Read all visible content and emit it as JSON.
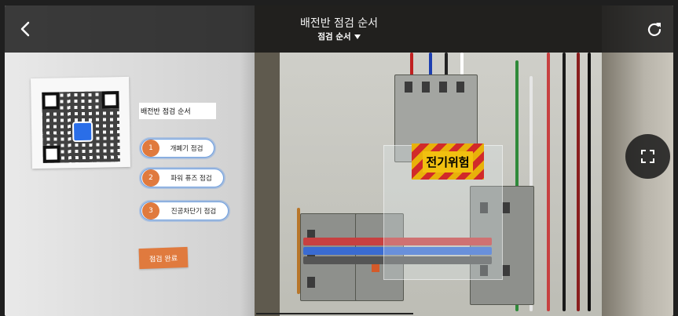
{
  "header": {
    "title": "배전반 점검 순서",
    "subtitle": "점검 순서",
    "back_icon": "chevron-left-icon",
    "refresh_icon": "refresh-icon"
  },
  "ar_overlay": {
    "title_label": "배전반 점검 순서",
    "steps": [
      {
        "number": "1",
        "label": "개폐기 점검"
      },
      {
        "number": "2",
        "label": "파워 퓨즈 점검"
      },
      {
        "number": "3",
        "label": "진공차단기 점검"
      }
    ],
    "done_button": "점검 완료",
    "accent_color": "#e07a3e",
    "highlight_color": "#6fa0e0"
  },
  "scene": {
    "warning_sign": "전기위험"
  },
  "controls": {
    "fullscreen_icon": "fullscreen-icon"
  }
}
